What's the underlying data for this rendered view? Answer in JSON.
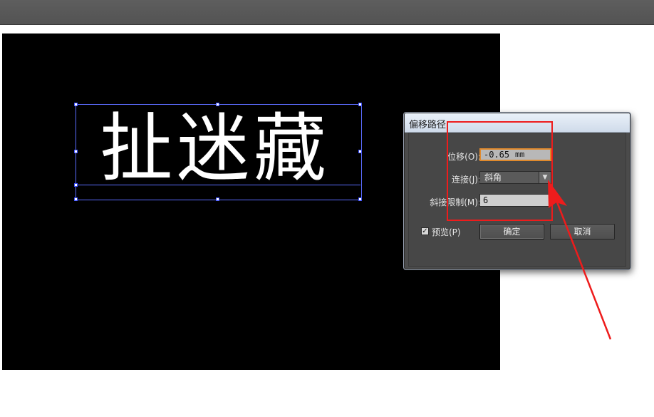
{
  "art_text": "扯迷藏",
  "dialog": {
    "title": "偏移路径",
    "offset_label": "位移(O):",
    "offset_value": "-0.65",
    "offset_unit": "mm",
    "join_label": "连接(J):",
    "join_value": "斜角",
    "miter_label": "斜接限制(M):",
    "miter_value": "6",
    "preview_label": "预览(P)",
    "preview_checked": "✓",
    "ok_label": "确定",
    "cancel_label": "取消"
  },
  "colors": {
    "annotation": "#ee1c1c",
    "selection": "#5b6cff",
    "focus": "#e08a2d"
  }
}
